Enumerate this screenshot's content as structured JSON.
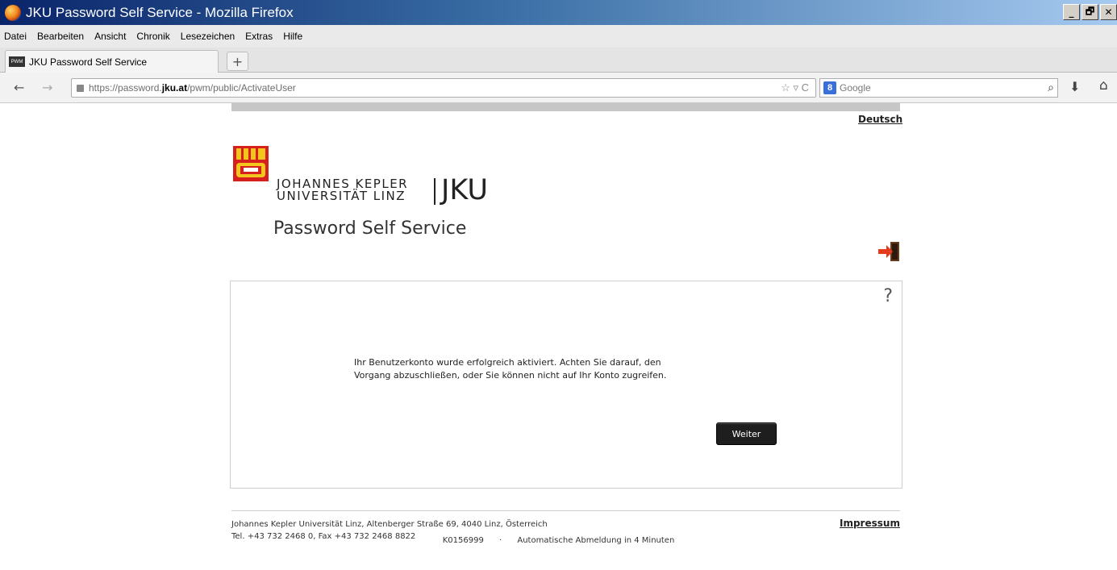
{
  "window": {
    "title": "JKU Password Self Service - Mozilla Firefox",
    "min": "_",
    "max": "🗗",
    "close": "✕"
  },
  "menu": [
    "Datei",
    "Bearbeiten",
    "Ansicht",
    "Chronik",
    "Lesezeichen",
    "Extras",
    "Hilfe"
  ],
  "tab": {
    "label": "JKU Password Self Service",
    "favicon": "PWM",
    "new_tab": "+"
  },
  "nav": {
    "back": "←",
    "forward": "→",
    "url_prefix": "https://password.",
    "url_domain": "jku.at",
    "url_path": "/pwm/public/ActivateUser",
    "url_controls": "☆ ▿ C",
    "search_engine_icon": "8",
    "search_placeholder": "Google",
    "search_glass": "⌕",
    "download": "⬇",
    "home": "⌂"
  },
  "page": {
    "language_link": "Deutsch",
    "logo_line1": "JOHANNES KEPLER",
    "logo_line2": "UNIVERSITÄT LINZ",
    "logo_abbr": "JKU",
    "app_title": "Password Self Service",
    "help": "?",
    "message_line1": "Ihr Benutzerkonto wurde erfolgreich aktiviert. Achten Sie darauf, den",
    "message_line2": "Vorgang abzuschließen, oder Sie können nicht auf Ihr Konto zugreifen.",
    "continue_label": "Weiter",
    "address_line1": "Johannes Kepler Universität Linz, Altenberger Straße 69, 4040 Linz, Österreich",
    "address_line2": "Tel. +43 732 2468 0, Fax +43 732 2468 8822",
    "impressum": "Impressum",
    "user_id": "K0156999",
    "separator": "·",
    "timeout": "Automatische Abmeldung in 4 Minuten"
  },
  "colors": {
    "title_bar": "#0a246a",
    "button_bg": "#1e1e1e",
    "seal_red": "#d6201e",
    "seal_yellow": "#f4c51c"
  }
}
